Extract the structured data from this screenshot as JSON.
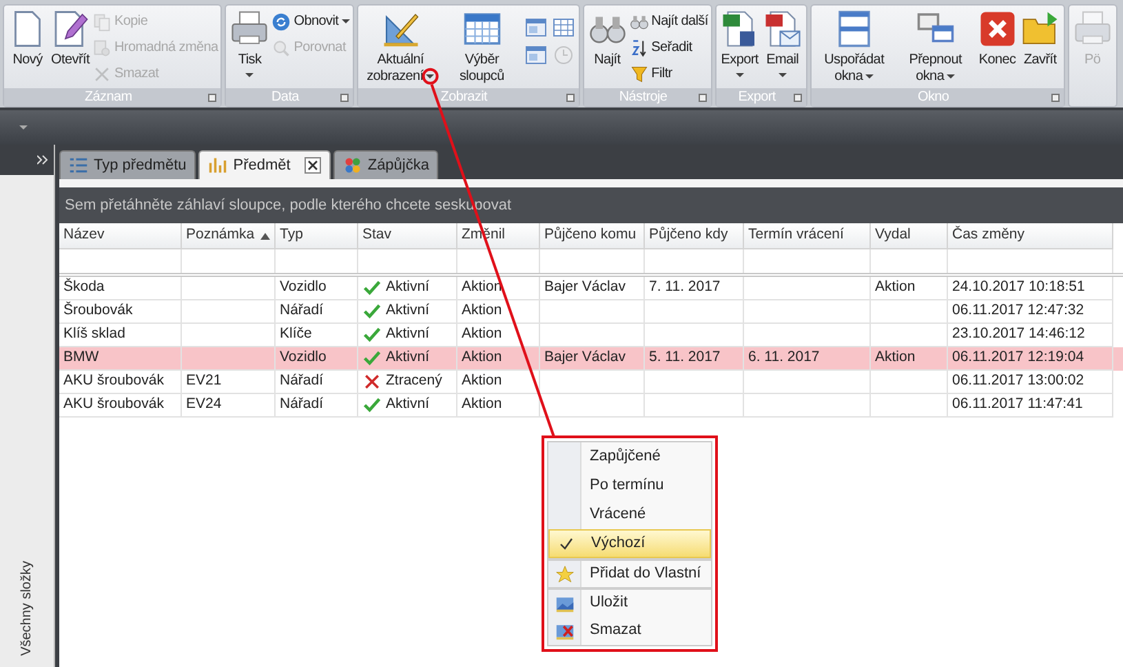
{
  "ribbon": {
    "groups": [
      {
        "label": "Záznam",
        "items": [
          {
            "kind": "large",
            "label": "Nový",
            "disabled": false,
            "dropdown": false
          },
          {
            "kind": "large",
            "label": "Otevřít",
            "disabled": false,
            "dropdown": false
          },
          {
            "kind": "small",
            "label": "Kopie",
            "disabled": true,
            "dropdown": false
          },
          {
            "kind": "small",
            "label": "Hromadná změna",
            "disabled": true,
            "dropdown": false
          },
          {
            "kind": "small",
            "label": "Smazat",
            "disabled": true,
            "dropdown": false
          }
        ]
      },
      {
        "label": "Data",
        "items": [
          {
            "kind": "large",
            "label": "Tisk",
            "disabled": false,
            "dropdown": true
          },
          {
            "kind": "small",
            "label": "Obnovit",
            "disabled": false,
            "dropdown": true
          },
          {
            "kind": "small",
            "label": "Porovnat",
            "disabled": true,
            "dropdown": false
          }
        ]
      },
      {
        "label": "Zobrazit",
        "items": [
          {
            "kind": "large",
            "label": "Aktuální zobrazení",
            "disabled": false,
            "dropdown": true
          },
          {
            "kind": "large",
            "label": "Výběr sloupců",
            "disabled": false,
            "dropdown": false
          },
          {
            "kind": "icon",
            "disabled": false
          },
          {
            "kind": "icon",
            "disabled": false
          },
          {
            "kind": "icon",
            "disabled": false
          },
          {
            "kind": "icon",
            "disabled": true
          }
        ]
      },
      {
        "label": "Nástroje",
        "items": [
          {
            "kind": "large",
            "label": "Najít",
            "disabled": false,
            "dropdown": false
          },
          {
            "kind": "small",
            "label": "Najít další",
            "disabled": false,
            "dropdown": false
          },
          {
            "kind": "small",
            "label": "Seřadit",
            "disabled": false,
            "dropdown": false
          },
          {
            "kind": "small",
            "label": "Filtr",
            "disabled": false,
            "dropdown": false
          }
        ]
      },
      {
        "label": "Export",
        "items": [
          {
            "kind": "large",
            "label": "Export",
            "disabled": false,
            "dropdown": true
          },
          {
            "kind": "large",
            "label": "Email",
            "disabled": false,
            "dropdown": true
          }
        ]
      },
      {
        "label": "Okno",
        "items": [
          {
            "kind": "large",
            "label": "Uspořádat okna",
            "disabled": false,
            "dropdown": true
          },
          {
            "kind": "large",
            "label": "Přepnout okna",
            "disabled": false,
            "dropdown": true
          },
          {
            "kind": "large",
            "label": "Konec",
            "disabled": false,
            "dropdown": false
          },
          {
            "kind": "large",
            "label": "Zavřít",
            "disabled": false,
            "dropdown": false
          }
        ]
      },
      {
        "items": [
          {
            "kind": "large",
            "label": "Pö",
            "disabled": true,
            "dropdown": false
          }
        ]
      }
    ]
  },
  "sidebar": {
    "label": "Všechny složky"
  },
  "tabs": [
    {
      "label": "Typ předmětu",
      "selected": false,
      "closable": false
    },
    {
      "label": "Předmět",
      "selected": true,
      "closable": true
    },
    {
      "label": "Zápůjčka",
      "selected": false,
      "closable": false
    }
  ],
  "group_panel": {
    "text": "Sem přetáhněte záhlaví sloupce, podle kterého chcete seskupovat"
  },
  "table": {
    "columns": [
      {
        "label": "Název",
        "sorted": false
      },
      {
        "label": "Poznámka",
        "sorted": true
      },
      {
        "label": "Typ",
        "sorted": false
      },
      {
        "label": "Stav",
        "sorted": false
      },
      {
        "label": "Změnil",
        "sorted": false
      },
      {
        "label": "Půjčeno komu",
        "sorted": false
      },
      {
        "label": "Půjčeno kdy",
        "sorted": false
      },
      {
        "label": "Termín vrácení",
        "sorted": false
      },
      {
        "label": "Vydal",
        "sorted": false
      },
      {
        "label": "Čas změny",
        "sorted": false
      }
    ],
    "rows": [
      {
        "highlighted": false,
        "cells": [
          "Škoda",
          "",
          "Vozidlo",
          {
            "kind": "ok",
            "text": "Aktivní"
          },
          "Aktion",
          "Bajer Václav",
          "7. 11. 2017",
          "",
          "Aktion",
          "24.10.2017 10:18:51"
        ]
      },
      {
        "highlighted": false,
        "cells": [
          "Šroubovák",
          "",
          "Nářadí",
          {
            "kind": "ok",
            "text": "Aktivní"
          },
          "Aktion",
          "",
          "",
          "",
          "",
          "06.11.2017 12:47:32"
        ]
      },
      {
        "highlighted": false,
        "cells": [
          "Klíš sklad",
          "",
          "Klíče",
          {
            "kind": "ok",
            "text": "Aktivní"
          },
          "Aktion",
          "",
          "",
          "",
          "",
          "23.10.2017 14:46:12"
        ]
      },
      {
        "highlighted": true,
        "cells": [
          "BMW",
          "",
          "Vozidlo",
          {
            "kind": "ok",
            "text": "Aktivní"
          },
          "Aktion",
          "Bajer Václav",
          "5. 11. 2017",
          "6. 11. 2017",
          "Aktion",
          "06.11.2017 12:19:04"
        ]
      },
      {
        "highlighted": false,
        "cells": [
          "AKU šroubovák",
          "EV21",
          "Nářadí",
          {
            "kind": "lost",
            "text": "Ztracený"
          },
          "Aktion",
          "",
          "",
          "",
          "",
          "06.11.2017 13:00:02"
        ]
      },
      {
        "highlighted": false,
        "cells": [
          "AKU šroubovák",
          "EV24",
          "Nářadí",
          {
            "kind": "ok",
            "text": "Aktivní"
          },
          "Aktion",
          "",
          "",
          "",
          "",
          "06.11.2017 11:47:41"
        ]
      }
    ]
  },
  "context_menu": {
    "items": [
      {
        "kind": "plain",
        "label": "Zapůjčené",
        "checked": false,
        "selected": false,
        "separator_before": false
      },
      {
        "kind": "plain",
        "label": "Po termínu",
        "checked": false,
        "selected": false,
        "separator_before": false
      },
      {
        "kind": "plain",
        "label": "Vrácené",
        "checked": false,
        "selected": false,
        "separator_before": false
      },
      {
        "kind": "plain",
        "label": "Výchozí",
        "checked": true,
        "selected": true,
        "separator_before": false
      },
      {
        "kind": "star",
        "label": "Přidat do Vlastní",
        "checked": false,
        "selected": false,
        "separator_before": true
      },
      {
        "kind": "save",
        "label": "Uložit",
        "checked": false,
        "selected": false,
        "separator_before": true
      },
      {
        "kind": "delete",
        "label": "Smazat",
        "checked": false,
        "selected": false,
        "separator_before": false
      }
    ]
  }
}
